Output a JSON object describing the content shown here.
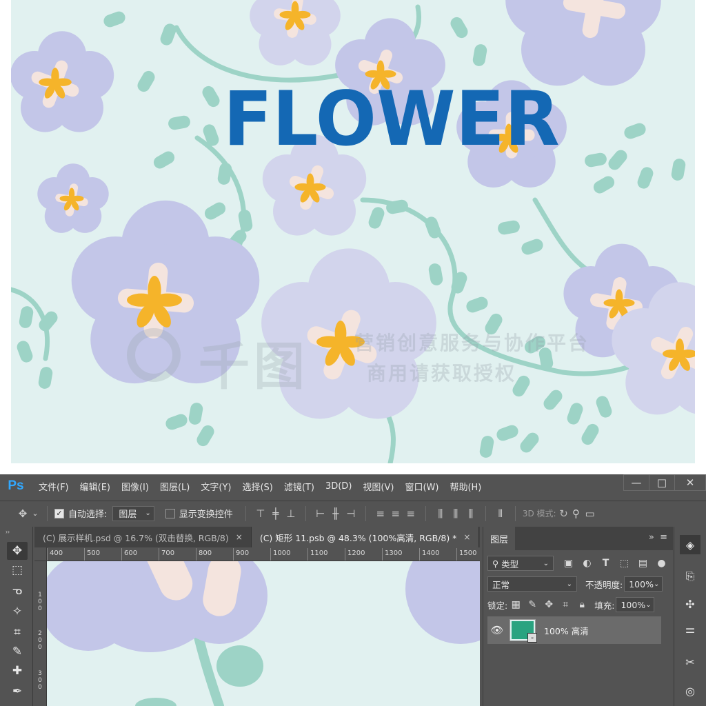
{
  "artwork": {
    "title_text": "FLOWER",
    "watermark_logo": "千图",
    "watermark_line1": "营销创意服务与协作平台",
    "watermark_line2": "商用请获取授权",
    "colors": {
      "background": "#e1f1f0",
      "title": "#1468b4",
      "petal": "#c3c6e8",
      "petal_light": "#d2d4ec",
      "stripe": "#f4e4de",
      "center": "#f5b42a",
      "leaf": "#9dd3c6"
    }
  },
  "photoshop": {
    "app_logo": "Ps",
    "menu": [
      "文件(F)",
      "编辑(E)",
      "图像(I)",
      "图层(L)",
      "文字(Y)",
      "选择(S)",
      "滤镜(T)",
      "3D(D)",
      "视图(V)",
      "窗口(W)",
      "帮助(H)"
    ],
    "window_controls": {
      "minimize": "—",
      "maximize": "□",
      "close": "✕"
    },
    "options": {
      "auto_select_label": "自动选择:",
      "auto_select_checked": true,
      "auto_select_target": "图层",
      "show_transform_label": "显示变换控件",
      "show_transform_checked": false,
      "mode_3d_label": "3D 模式:"
    },
    "tabs": [
      {
        "label": "(C) 展示样机.psd @ 16.7% (双击替换, RGB/8)",
        "close": "×",
        "active": false
      },
      {
        "label": "(C) 矩形 11.psb @ 48.3% (100%高清, RGB/8) *",
        "close": "×",
        "active": true
      }
    ],
    "ruler_h": [
      "400",
      "500",
      "600",
      "700",
      "800",
      "900",
      "1000",
      "1100",
      "1200",
      "1300",
      "1400",
      "1500"
    ],
    "ruler_v": [
      "100",
      "200",
      "300"
    ],
    "layers_panel": {
      "tab_label": "图层",
      "filter_label": "类型",
      "blend_mode": "正常",
      "opacity_label": "不透明度:",
      "opacity_value": "100%",
      "lock_label": "锁定:",
      "fill_label": "填充:",
      "fill_value": "100%",
      "layer": {
        "name": "100% 高清",
        "visible": true,
        "thumb_color": "#2aa380"
      }
    }
  }
}
